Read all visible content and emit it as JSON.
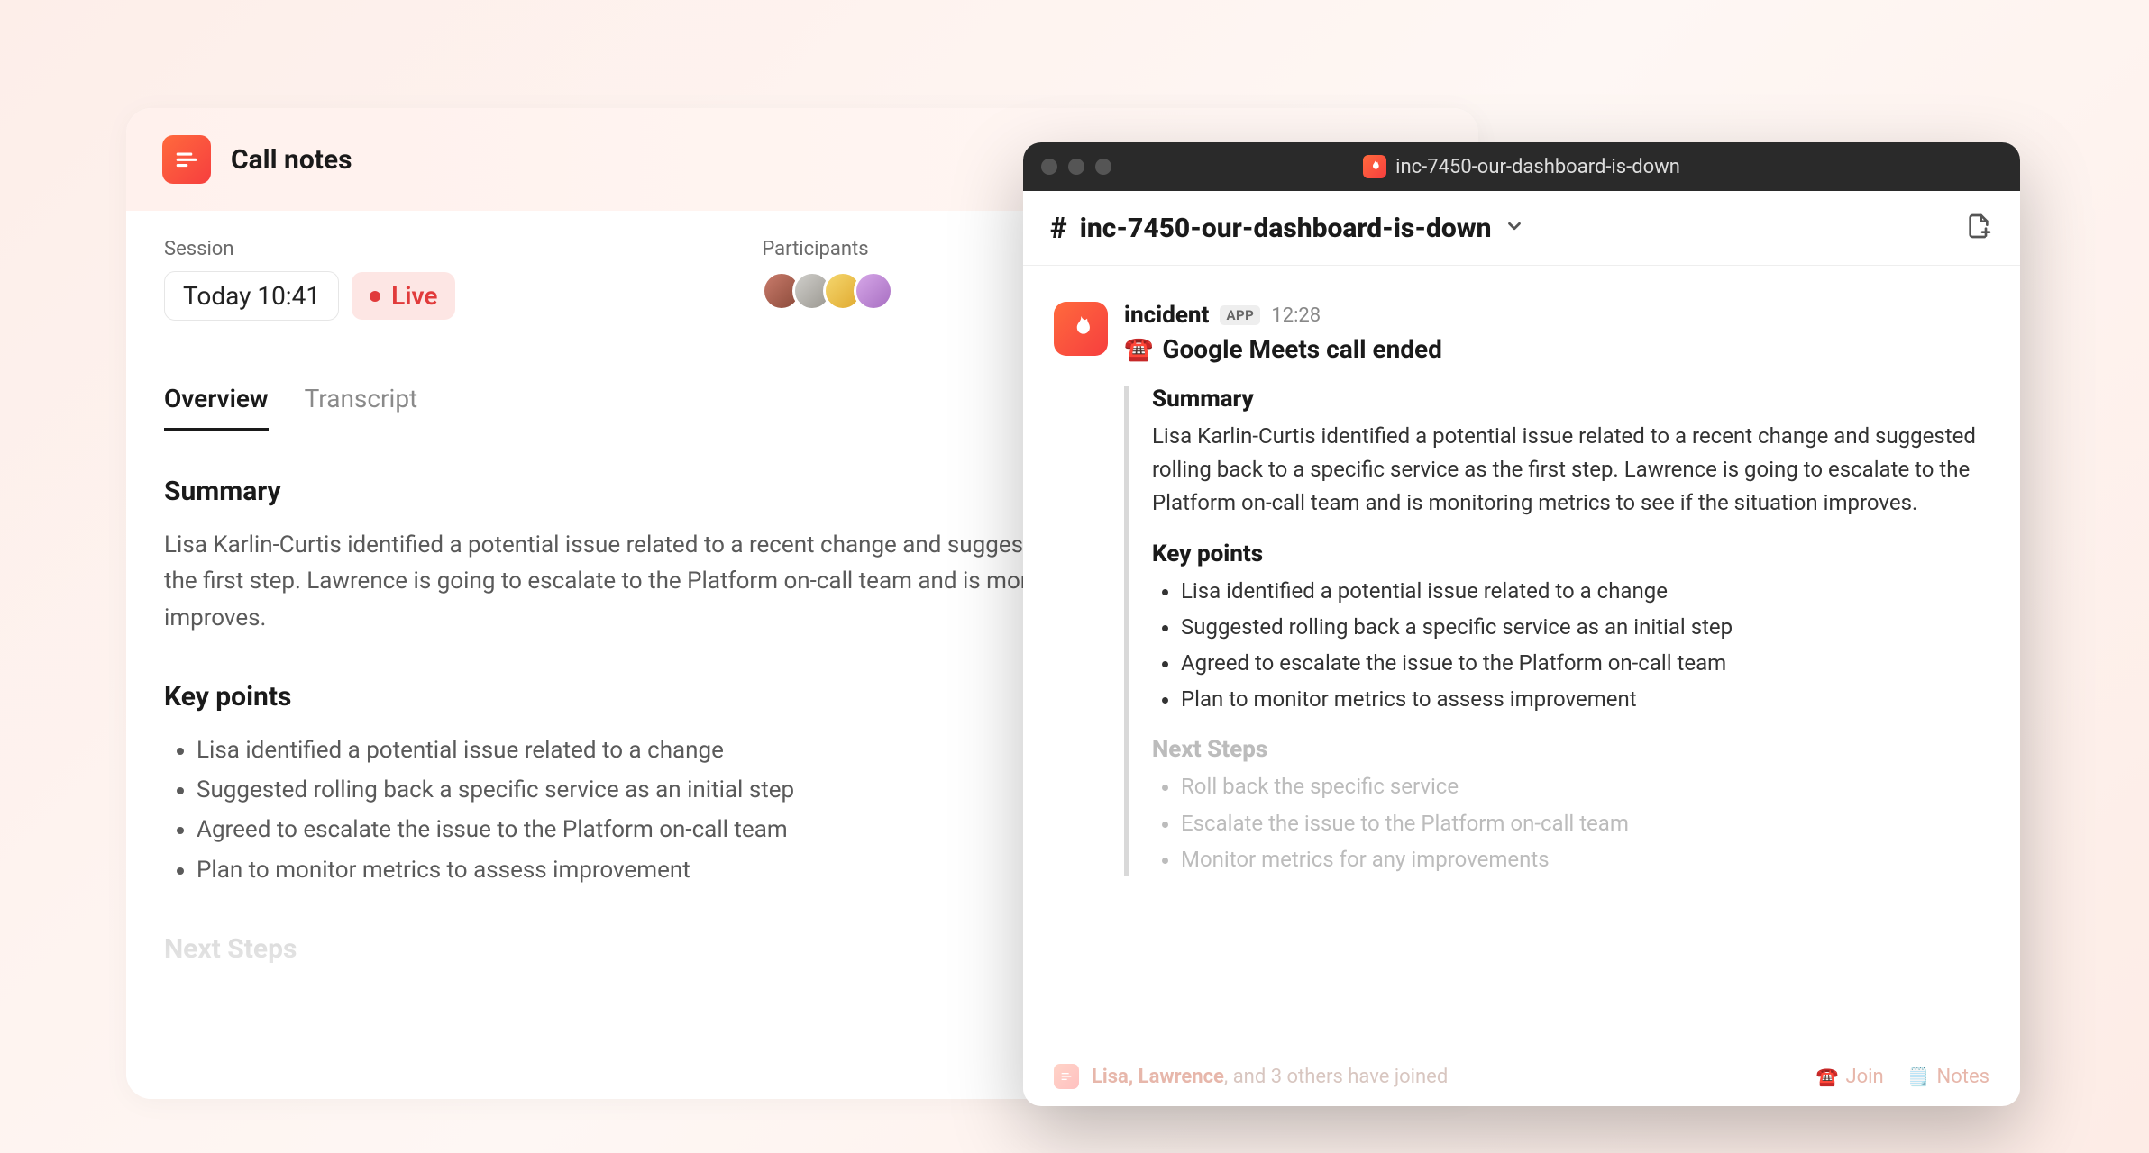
{
  "left": {
    "title": "Call notes",
    "session_label": "Session",
    "session_time": "Today 10:41",
    "live_label": "Live",
    "participants_label": "Participants",
    "tabs": {
      "overview": "Overview",
      "transcript": "Transcript"
    },
    "summary_heading": "Summary",
    "summary_text": "Lisa Karlin-Curtis identified a potential issue related to a recent change and suggested rolling back to a specific service as the first step. Lawrence is going to escalate to the Platform on-call team and is monitoring metrics to see if the situation improves.",
    "key_points_heading": "Key points",
    "key_points": [
      "Lisa identified a potential issue related to a change",
      "Suggested rolling back a specific service as an initial step",
      "Agreed to escalate the issue to the Platform on-call team",
      "Plan to monitor metrics to assess improvement"
    ],
    "next_steps_heading": "Next Steps"
  },
  "slack": {
    "window_title": "inc-7450-our-dashboard-is-down",
    "channel_name": "inc-7450-our-dashboard-is-down",
    "author": "incident",
    "app_badge": "APP",
    "time": "12:28",
    "msg_title": "Google Meets call ended",
    "summary_heading": "Summary",
    "summary_text": "Lisa Karlin-Curtis identified a potential issue related to a recent change and suggested rolling back to a specific service as the first step. Lawrence is going to escalate to the Platform on-call team and is monitoring metrics to see if the situation improves.",
    "key_points_heading": "Key points",
    "key_points": [
      "Lisa identified a potential issue related to a change",
      "Suggested rolling back a specific service as an initial step",
      "Agreed to escalate the issue to the Platform on-call team",
      "Plan to monitor metrics to assess improvement"
    ],
    "next_steps_heading": "Next Steps",
    "next_steps": [
      "Roll back the specific service",
      "Escalate the issue to the Platform on-call team",
      "Monitor metrics for any improvements"
    ],
    "footer": {
      "joined_prefix_names": "Lisa, Lawrence",
      "joined_suffix": ", and 3 others have joined",
      "join_label": "Join",
      "notes_label": "Notes"
    }
  }
}
